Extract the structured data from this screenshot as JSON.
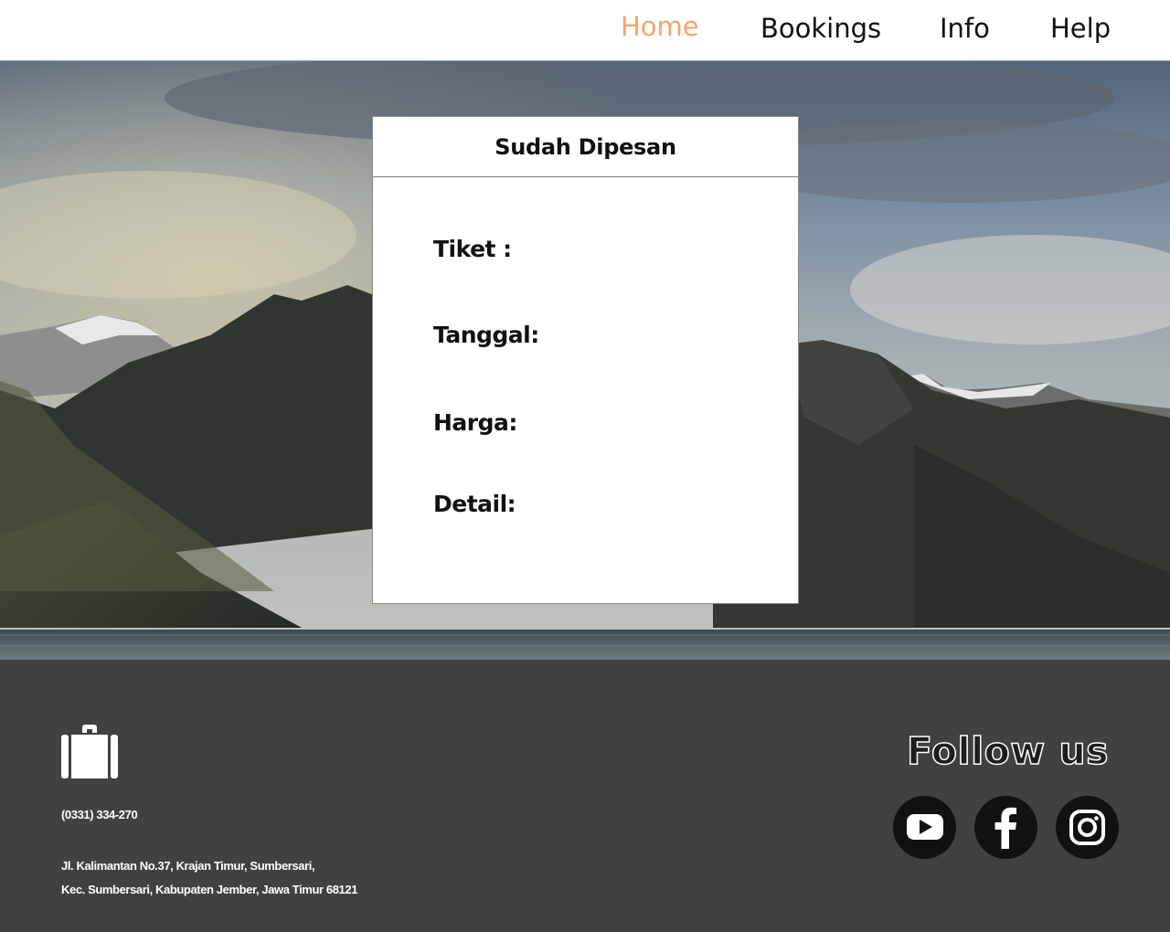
{
  "nav": {
    "items": [
      {
        "label": "Home",
        "active": true
      },
      {
        "label": "Bookings",
        "active": false
      },
      {
        "label": "Info",
        "active": false
      },
      {
        "label": "Help",
        "active": false
      }
    ],
    "active_color": "#f4a66b"
  },
  "card": {
    "title": "Sudah Dipesan",
    "fields": [
      {
        "label": "Tiket :"
      },
      {
        "label": "Tanggal:"
      },
      {
        "label": "Harga:"
      },
      {
        "label": "Detail:"
      }
    ]
  },
  "footer": {
    "brand_icon": "briefcase-icon",
    "phone": "(0331) 334-270",
    "address_line1": "Jl. Kalimantan No.37, Krajan Timur, Sumbersari,",
    "address_line2": "Kec. Sumbersari, Kabupaten Jember, Jawa Timur 68121",
    "follow_label": "Follow us",
    "social": [
      {
        "icon": "youtube-icon"
      },
      {
        "icon": "facebook-icon"
      },
      {
        "icon": "instagram-icon"
      }
    ],
    "background": "#414141"
  }
}
